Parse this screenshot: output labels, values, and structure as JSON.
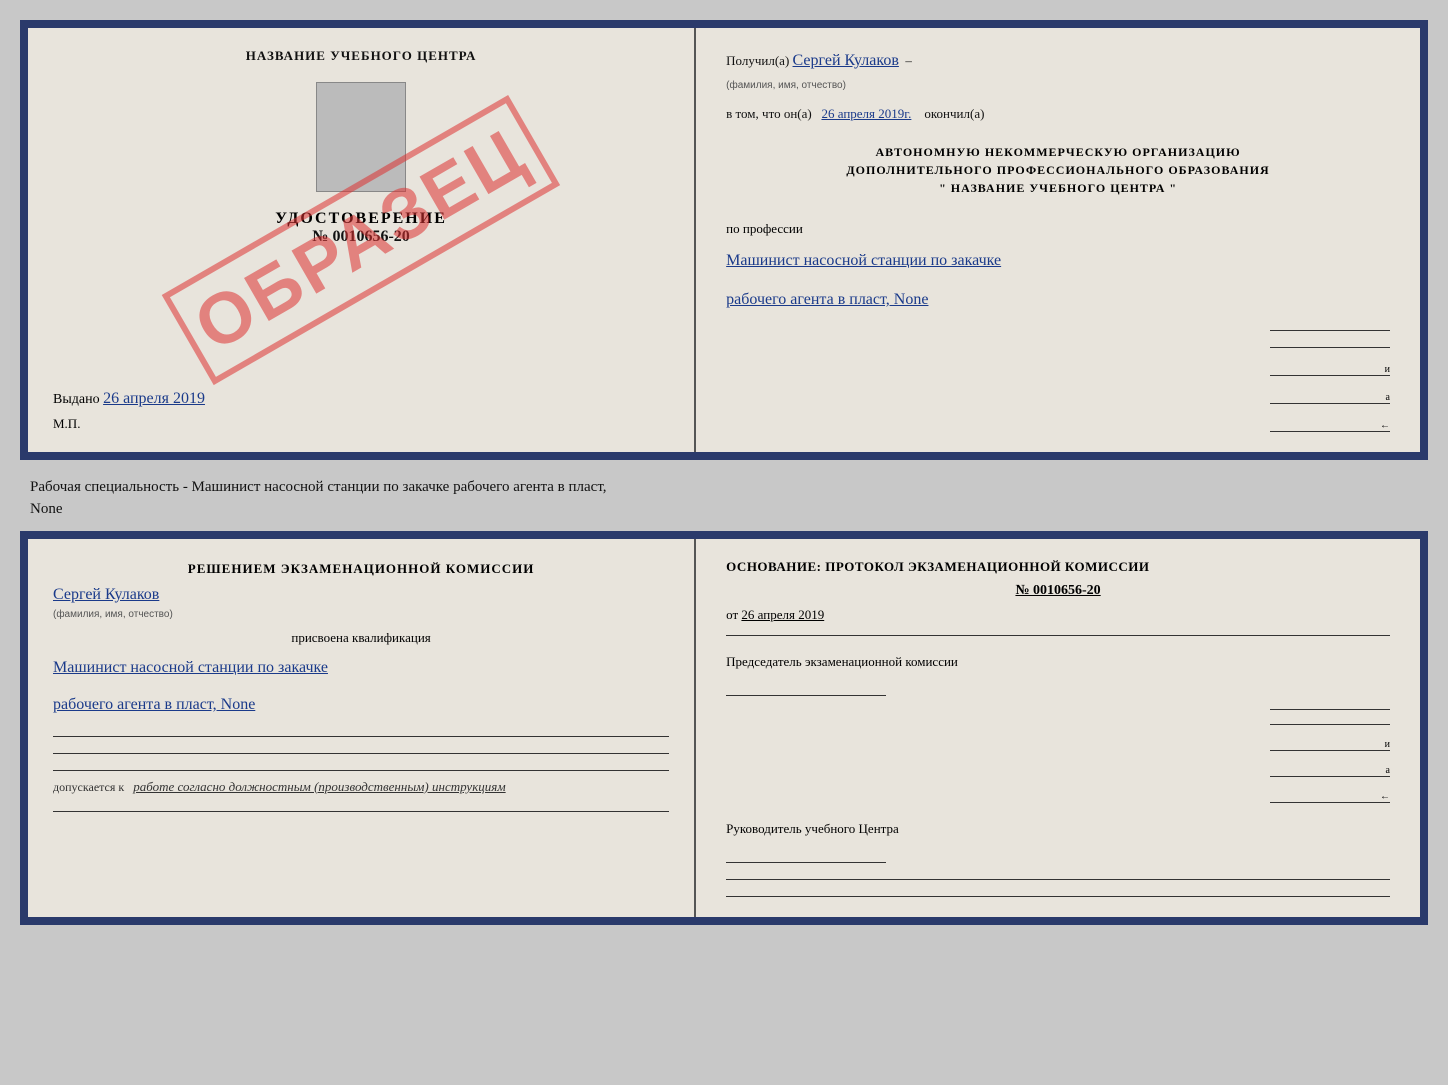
{
  "background_color": "#c8c8c8",
  "border_color": "#2a3a6b",
  "doc_top": {
    "left": {
      "center_title": "НАЗВАНИЕ УЧЕБНОГО ЦЕНТРА",
      "udostoverenie": "УДОСТОВЕРЕНИЕ",
      "number": "№ 0010656-20",
      "vydano_label": "Выдано",
      "vydano_date": "26 апреля 2019",
      "mp": "М.П.",
      "stamp": "ОБРАЗЕЦ"
    },
    "right": {
      "poluchil_label": "Получил(а)",
      "poluchil_name": "Сергей Кулаков",
      "familiya_hint": "(фамилия, имя, отчество)",
      "vtom_label": "в том, что он(а)",
      "vtom_date": "26 апреля 2019г.",
      "okonchil": "окончил(а)",
      "org_line1": "АВТОНОМНУЮ НЕКОММЕРЧЕСКУЮ ОРГАНИЗАЦИЮ",
      "org_line2": "ДОПОЛНИТЕЛЬНОГО ПРОФЕССИОНАЛЬНОГО ОБРАЗОВАНИЯ",
      "org_line3": "\"    НАЗВАНИЕ УЧЕБНОГО ЦЕНТРА    \"",
      "po_professii": "по профессии",
      "profession_line1": "Машинист насосной станции по закачке",
      "profession_line2": "рабочего агента в пласт, None"
    }
  },
  "description": {
    "text": "Рабочая специальность - Машинист насосной станции по закачке рабочего агента в пласт,",
    "text2": "None"
  },
  "doc_bottom": {
    "left": {
      "commission_title": "Решением экзаменационной комиссии",
      "name": "Сергей Кулаков",
      "familiya_hint": "(фамилия, имя, отчество)",
      "prisvoena": "присвоена квалификация",
      "profession_line1": "Машинист насосной станции по закачке",
      "profession_line2": "рабочего агента в пласт, None",
      "dopuskaetsya_label": "допускается к",
      "dopuskaetsya_text": "работе согласно должностным (производственным) инструкциям"
    },
    "right": {
      "osnov_label": "Основание: протокол экзаменационной комиссии",
      "protocol_num": "№ 0010656-20",
      "ot_label": "от",
      "ot_date": "26 апреля 2019",
      "predsedatel_title": "Председатель экзаменационной комиссии",
      "rukovoditel_title": "Руководитель учебного Центра"
    }
  }
}
